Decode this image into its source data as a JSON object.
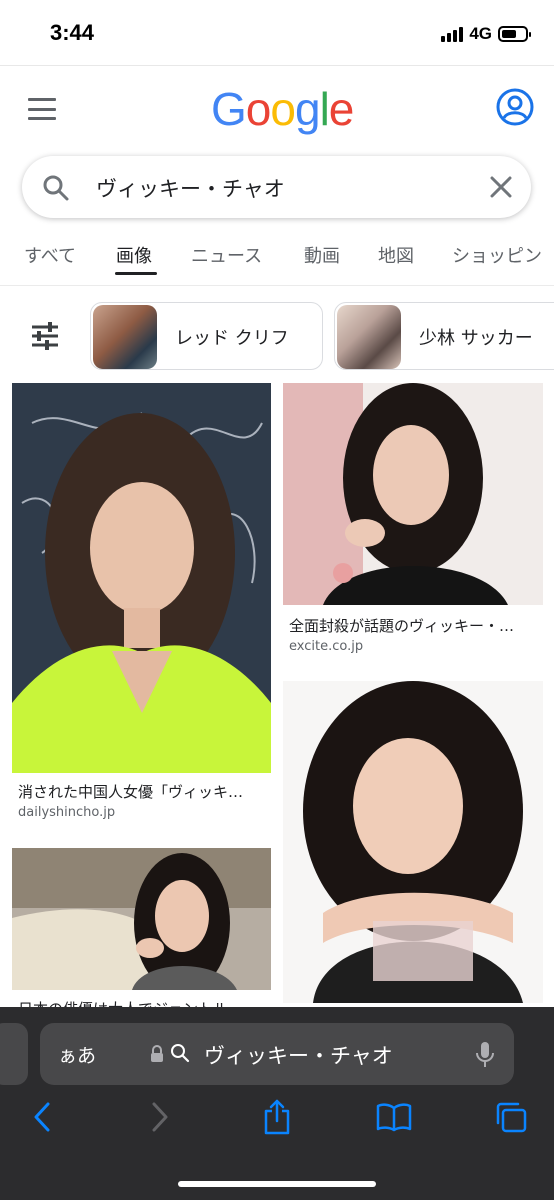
{
  "status_bar": {
    "time": "3:44",
    "network": "4G"
  },
  "header": {
    "logo_letters": [
      "G",
      "o",
      "o",
      "g",
      "l",
      "e"
    ],
    "logo_colors": [
      "#4285F4",
      "#EA4335",
      "#FBBC05",
      "#4285F4",
      "#34A853",
      "#EA4335"
    ]
  },
  "search": {
    "query": "ヴィッキー・チャオ"
  },
  "tabs": [
    {
      "label": "すべて",
      "active": false
    },
    {
      "label": "画像",
      "active": true
    },
    {
      "label": "ニュース",
      "active": false
    },
    {
      "label": "動画",
      "active": false
    },
    {
      "label": "地図",
      "active": false
    },
    {
      "label": "ショッピン",
      "active": false
    }
  ],
  "chips": [
    {
      "label": "レッド クリフ"
    },
    {
      "label": "少林 サッカー"
    }
  ],
  "results": [
    {
      "title": "消された中国人女優「ヴィッキ…",
      "source": "dailyshincho.jp"
    },
    {
      "title": "全面封殺が話題のヴィッキー・…",
      "source": "excite.co.jp"
    },
    {
      "title": "",
      "source": ""
    },
    {
      "title": "日本の俳優は大人でジェントル",
      "source": ""
    }
  ],
  "safari": {
    "aa_label": "ぁあ",
    "address_text": "ヴィッキー・チャオ"
  },
  "colors": {
    "accent_blue": "#1a73e8",
    "safari_bar": "#2c2c2e",
    "safari_tint": "#0a84ff"
  }
}
